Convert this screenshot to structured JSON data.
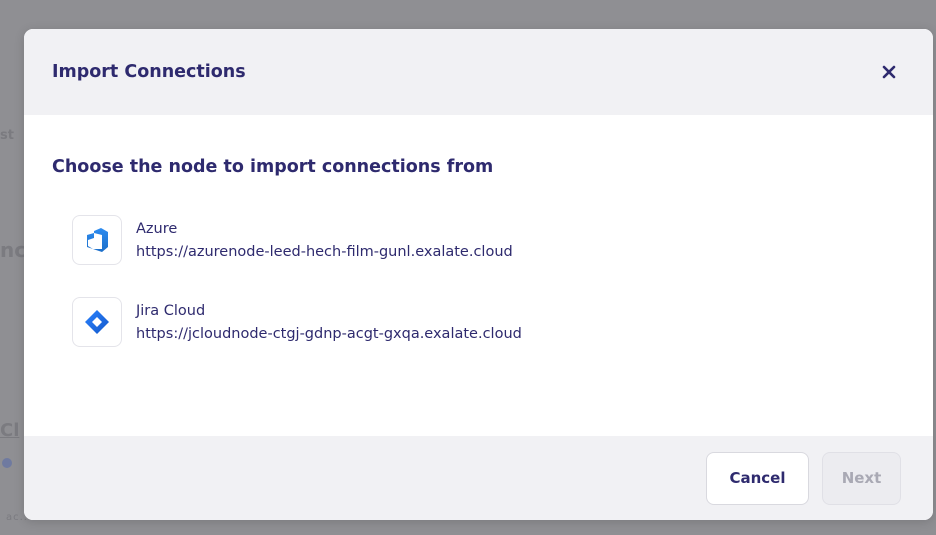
{
  "background": {
    "fragments": [
      "st",
      "nc",
      "Cl",
      "ac...."
    ]
  },
  "modal": {
    "title": "Import Connections",
    "close_icon": "close-icon",
    "section_title": "Choose the node to import connections from",
    "nodes": [
      {
        "name": "Azure",
        "url": "https://azurenode-leed-hech-film-gunl.exalate.cloud",
        "icon": "azure-devops-icon",
        "color": "#2b7fd9"
      },
      {
        "name": "Jira Cloud",
        "url": "https://jcloudnode-ctgj-gdnp-acgt-gxqa.exalate.cloud",
        "icon": "jira-icon",
        "color": "#2a78f0"
      }
    ],
    "footer": {
      "cancel_label": "Cancel",
      "next_label": "Next"
    }
  },
  "colors": {
    "primary_text": "#2e2a6e",
    "overlay": "#8f8f93",
    "header_bg": "#f1f1f4"
  }
}
